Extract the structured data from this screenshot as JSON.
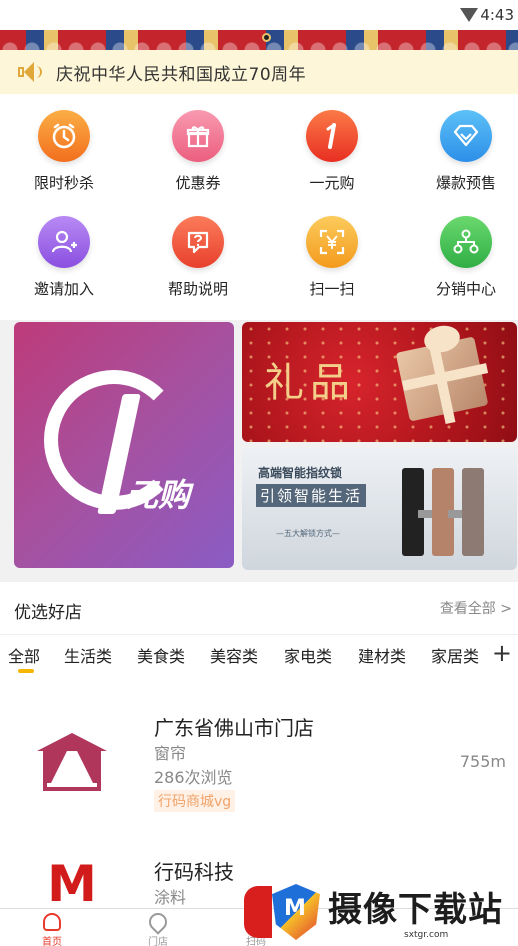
{
  "status_bar": {
    "time": "4:43"
  },
  "notice": {
    "text": "庆祝中华人民共和国成立70周年"
  },
  "grid": [
    {
      "label": "限时秒杀",
      "icon": "clock-icon",
      "color": "#f58a2b"
    },
    {
      "label": "优惠券",
      "icon": "gift-icon",
      "color": "#f0708a"
    },
    {
      "label": "一元购",
      "icon": "one-icon",
      "color": "#ef4a2e"
    },
    {
      "label": "爆款预售",
      "icon": "diamond-icon",
      "color": "#3fa6f0"
    },
    {
      "label": "邀请加入",
      "icon": "add-user-icon",
      "color": "#9b63e6"
    },
    {
      "label": "帮助说明",
      "icon": "help-icon",
      "color": "#f0543b"
    },
    {
      "label": "扫一扫",
      "icon": "scan-icon",
      "color": "#f7a52c"
    },
    {
      "label": "分销中心",
      "icon": "network-icon",
      "color": "#3bbf52"
    }
  ],
  "promos": {
    "one_yuan": {
      "text": "元购"
    },
    "gift": {
      "text": "礼品"
    },
    "lock": {
      "line1": "高端智能指纹锁",
      "line2": "引领智能生活",
      "line3": "—五大解锁方式—"
    }
  },
  "shops": {
    "title": "优选好店",
    "more": "查看全部 >",
    "categories": [
      "全部",
      "生活类",
      "美食类",
      "美容类",
      "家电类",
      "建材类",
      "家居类"
    ],
    "add_symbol": "+",
    "items": [
      {
        "name": "广东省佛山市门店",
        "kind": "窗帘",
        "views": "286次浏览",
        "tag": "行码商城vg",
        "distance": "755m"
      },
      {
        "name": "行码科技",
        "kind": "涂料"
      }
    ]
  },
  "tabbar": [
    {
      "label": "首页",
      "active": true
    },
    {
      "label": "门店",
      "active": false
    },
    {
      "label": "扫码",
      "active": false
    }
  ],
  "watermark": {
    "text": "摄像下载站",
    "url": "sxtgr.com"
  }
}
